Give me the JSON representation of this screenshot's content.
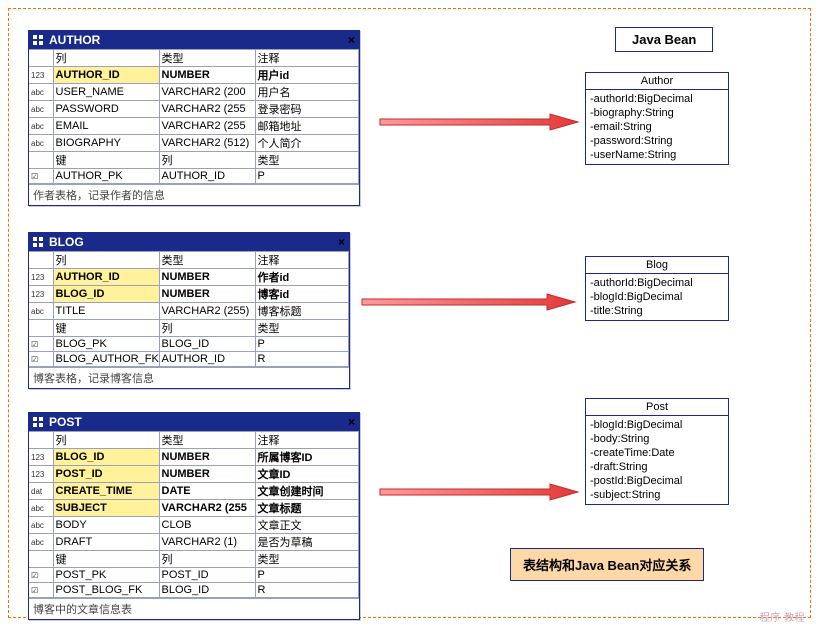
{
  "header_label": "Java Bean",
  "caption": "表结构和Java Bean对应关系",
  "watermark": "程序 教程",
  "col_headers": {
    "col": "列",
    "type": "类型",
    "comment": "注释",
    "key": "键"
  },
  "author": {
    "title": "AUTHOR",
    "rows": [
      {
        "i": "123",
        "col": "AUTHOR_ID",
        "type": "NUMBER",
        "comment": "用户id",
        "hl": true
      },
      {
        "i": "abc",
        "col": "USER_NAME",
        "type": "VARCHAR2 (200",
        "comment": "用户名"
      },
      {
        "i": "abc",
        "col": "PASSWORD",
        "type": "VARCHAR2 (255",
        "comment": "登录密码"
      },
      {
        "i": "abc",
        "col": "EMAIL",
        "type": "VARCHAR2 (255",
        "comment": "邮箱地址"
      },
      {
        "i": "abc",
        "col": "BIOGRAPHY",
        "type": "VARCHAR2 (512)",
        "comment": "个人简介"
      }
    ],
    "keys": [
      {
        "i": "✓",
        "key": "AUTHOR_PK",
        "col": "AUTHOR_ID",
        "type": "P"
      }
    ],
    "footer": "作者表格，记录作者的信息"
  },
  "blog": {
    "title": "BLOG",
    "rows": [
      {
        "i": "123",
        "col": "AUTHOR_ID",
        "type": "NUMBER",
        "comment": "作者id",
        "hl": true
      },
      {
        "i": "123",
        "col": "BLOG_ID",
        "type": "NUMBER",
        "comment": "博客id",
        "hl": true
      },
      {
        "i": "abc",
        "col": "TITLE",
        "type": "VARCHAR2 (255)",
        "comment": "博客标题"
      }
    ],
    "keys": [
      {
        "i": "✓",
        "key": "BLOG_PK",
        "col": "BLOG_ID",
        "type": "P"
      },
      {
        "i": "✓",
        "key": "BLOG_AUTHOR_FK",
        "col": "AUTHOR_ID",
        "type": "R"
      }
    ],
    "footer": "博客表格，记录博客信息"
  },
  "post": {
    "title": "POST",
    "rows": [
      {
        "i": "123",
        "col": "BLOG_ID",
        "type": "NUMBER",
        "comment": "所属博客ID",
        "hl": true
      },
      {
        "i": "123",
        "col": "POST_ID",
        "type": "NUMBER",
        "comment": "文章ID",
        "hl": true
      },
      {
        "i": "dat",
        "col": "CREATE_TIME",
        "type": "DATE",
        "comment": "文章创建时间",
        "hl": true
      },
      {
        "i": "abc",
        "col": "SUBJECT",
        "type": "VARCHAR2 (255",
        "comment": "文章标题",
        "hl": true
      },
      {
        "i": "abc",
        "col": "BODY",
        "type": "CLOB",
        "comment": "文章正文"
      },
      {
        "i": "abc",
        "col": "DRAFT",
        "type": "VARCHAR2 (1)",
        "comment": "是否为草稿"
      }
    ],
    "keys": [
      {
        "i": "✓",
        "key": "POST_PK",
        "col": "POST_ID",
        "type": "P"
      },
      {
        "i": "✓",
        "key": "POST_BLOG_FK",
        "col": "BLOG_ID",
        "type": "R"
      }
    ],
    "footer": "博客中的文章信息表"
  },
  "bean_author": {
    "name": "Author",
    "fields": [
      "-authorId:BigDecimal",
      "-biography:String",
      "-email:String",
      "-password:String",
      "-userName:String"
    ]
  },
  "bean_blog": {
    "name": "Blog",
    "fields": [
      "-authorId:BigDecimal",
      "-blogId:BigDecimal",
      "-title:String"
    ]
  },
  "bean_post": {
    "name": "Post",
    "fields": [
      "-blogId:BigDecimal",
      "-body:String",
      "-createTime:Date",
      "-draft:String",
      "-postId:BigDecimal",
      "-subject:String"
    ]
  },
  "chart_data": {
    "type": "table",
    "title": "ER tables to Java Bean mapping",
    "tables": [
      {
        "name": "AUTHOR",
        "description": "作者表格，记录作者的信息",
        "columns": [
          {
            "name": "AUTHOR_ID",
            "type": "NUMBER",
            "comment": "用户id",
            "pk": true
          },
          {
            "name": "USER_NAME",
            "type": "VARCHAR2(200)",
            "comment": "用户名"
          },
          {
            "name": "PASSWORD",
            "type": "VARCHAR2(255)",
            "comment": "登录密码"
          },
          {
            "name": "EMAIL",
            "type": "VARCHAR2(255)",
            "comment": "邮箱地址"
          },
          {
            "name": "BIOGRAPHY",
            "type": "VARCHAR2(512)",
            "comment": "个人简介"
          }
        ],
        "keys": [
          {
            "name": "AUTHOR_PK",
            "column": "AUTHOR_ID",
            "type": "P"
          }
        ],
        "bean": {
          "name": "Author",
          "fields": {
            "authorId": "BigDecimal",
            "biography": "String",
            "email": "String",
            "password": "String",
            "userName": "String"
          }
        }
      },
      {
        "name": "BLOG",
        "description": "博客表格，记录博客信息",
        "columns": [
          {
            "name": "AUTHOR_ID",
            "type": "NUMBER",
            "comment": "作者id"
          },
          {
            "name": "BLOG_ID",
            "type": "NUMBER",
            "comment": "博客id",
            "pk": true
          },
          {
            "name": "TITLE",
            "type": "VARCHAR2(255)",
            "comment": "博客标题"
          }
        ],
        "keys": [
          {
            "name": "BLOG_PK",
            "column": "BLOG_ID",
            "type": "P"
          },
          {
            "name": "BLOG_AUTHOR_FK",
            "column": "AUTHOR_ID",
            "type": "R"
          }
        ],
        "bean": {
          "name": "Blog",
          "fields": {
            "authorId": "BigDecimal",
            "blogId": "BigDecimal",
            "title": "String"
          }
        }
      },
      {
        "name": "POST",
        "description": "博客中的文章信息表",
        "columns": [
          {
            "name": "BLOG_ID",
            "type": "NUMBER",
            "comment": "所属博客ID"
          },
          {
            "name": "POST_ID",
            "type": "NUMBER",
            "comment": "文章ID",
            "pk": true
          },
          {
            "name": "CREATE_TIME",
            "type": "DATE",
            "comment": "文章创建时间"
          },
          {
            "name": "SUBJECT",
            "type": "VARCHAR2(255)",
            "comment": "文章标题"
          },
          {
            "name": "BODY",
            "type": "CLOB",
            "comment": "文章正文"
          },
          {
            "name": "DRAFT",
            "type": "VARCHAR2(1)",
            "comment": "是否为草稿"
          }
        ],
        "keys": [
          {
            "name": "POST_PK",
            "column": "POST_ID",
            "type": "P"
          },
          {
            "name": "POST_BLOG_FK",
            "column": "BLOG_ID",
            "type": "R"
          }
        ],
        "bean": {
          "name": "Post",
          "fields": {
            "blogId": "BigDecimal",
            "body": "String",
            "createTime": "Date",
            "draft": "String",
            "postId": "BigDecimal",
            "subject": "String"
          }
        }
      }
    ]
  }
}
